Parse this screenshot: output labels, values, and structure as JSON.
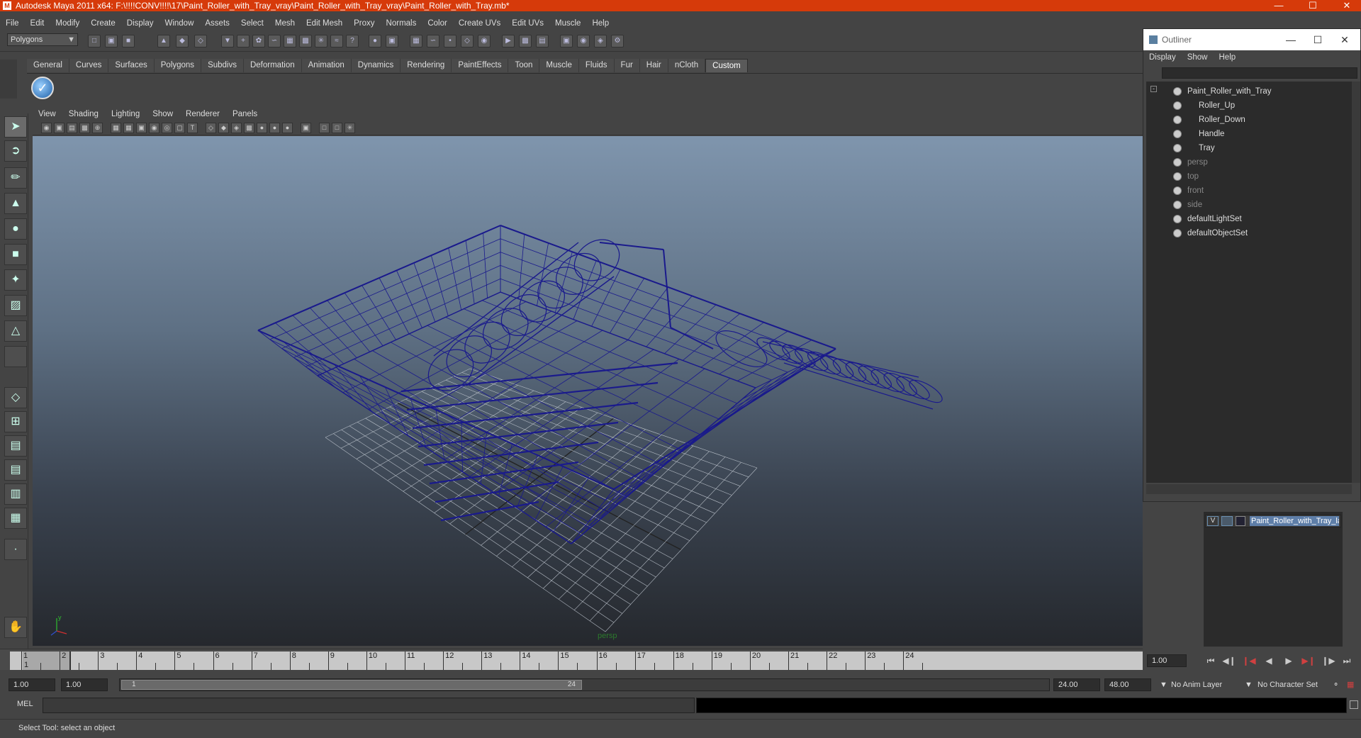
{
  "window": {
    "title": "Autodesk Maya 2011 x64: F:\\!!!!CONV!!!!\\17\\Paint_Roller_with_Tray_vray\\Paint_Roller_with_Tray_vray\\Paint_Roller_with_Tray.mb*"
  },
  "menubar": [
    "File",
    "Edit",
    "Modify",
    "Create",
    "Display",
    "Window",
    "Assets",
    "Select",
    "Mesh",
    "Edit Mesh",
    "Proxy",
    "Normals",
    "Color",
    "Create UVs",
    "Edit UVs",
    "Muscle",
    "Help"
  ],
  "status_line": {
    "mode": "Polygons"
  },
  "shelf": {
    "tabs": [
      "General",
      "Curves",
      "Surfaces",
      "Polygons",
      "Subdivs",
      "Deformation",
      "Animation",
      "Dynamics",
      "Rendering",
      "PaintEffects",
      "Toon",
      "Muscle",
      "Fluids",
      "Fur",
      "Hair",
      "nCloth",
      "Custom"
    ],
    "active_tab": "Custom"
  },
  "panel_menu": [
    "View",
    "Shading",
    "Lighting",
    "Show",
    "Renderer",
    "Panels"
  ],
  "viewport": {
    "camera": "persp",
    "wire_color": "#1a1a8c"
  },
  "outliner": {
    "title": "Outliner",
    "menu": [
      "Display",
      "Show",
      "Help"
    ],
    "items": [
      {
        "label": "Paint_Roller_with_Tray",
        "depth": 0,
        "dim": false
      },
      {
        "label": "Roller_Up",
        "depth": 1,
        "dim": false
      },
      {
        "label": "Roller_Down",
        "depth": 1,
        "dim": false
      },
      {
        "label": "Handle",
        "depth": 1,
        "dim": false
      },
      {
        "label": "Tray",
        "depth": 1,
        "dim": false
      },
      {
        "label": "persp",
        "depth": 0,
        "dim": true
      },
      {
        "label": "top",
        "depth": 0,
        "dim": true
      },
      {
        "label": "front",
        "depth": 0,
        "dim": true
      },
      {
        "label": "side",
        "depth": 0,
        "dim": true
      },
      {
        "label": "defaultLightSet",
        "depth": 0,
        "dim": false
      },
      {
        "label": "defaultObjectSet",
        "depth": 0,
        "dim": false
      }
    ]
  },
  "layers": {
    "visible_flag": "V",
    "items": [
      {
        "name": "Paint_Roller_with_Tray_la"
      }
    ]
  },
  "timeline": {
    "ticks": [
      1,
      2,
      3,
      4,
      5,
      6,
      7,
      8,
      9,
      10,
      11,
      12,
      13,
      14,
      15,
      16,
      17,
      18,
      19,
      20,
      21,
      22,
      23,
      24
    ],
    "current_frame": "1",
    "current_frame_field": "1.00"
  },
  "range": {
    "start": "1.00",
    "anim_start": "1.00",
    "knob_start": "1",
    "knob_end": "24",
    "end": "24.00",
    "anim_end": "48.00",
    "anim_layer": "No Anim Layer",
    "character_set": "No Character Set"
  },
  "command_line": {
    "label": "MEL"
  },
  "help_line": {
    "text": "Select Tool: select an object"
  }
}
